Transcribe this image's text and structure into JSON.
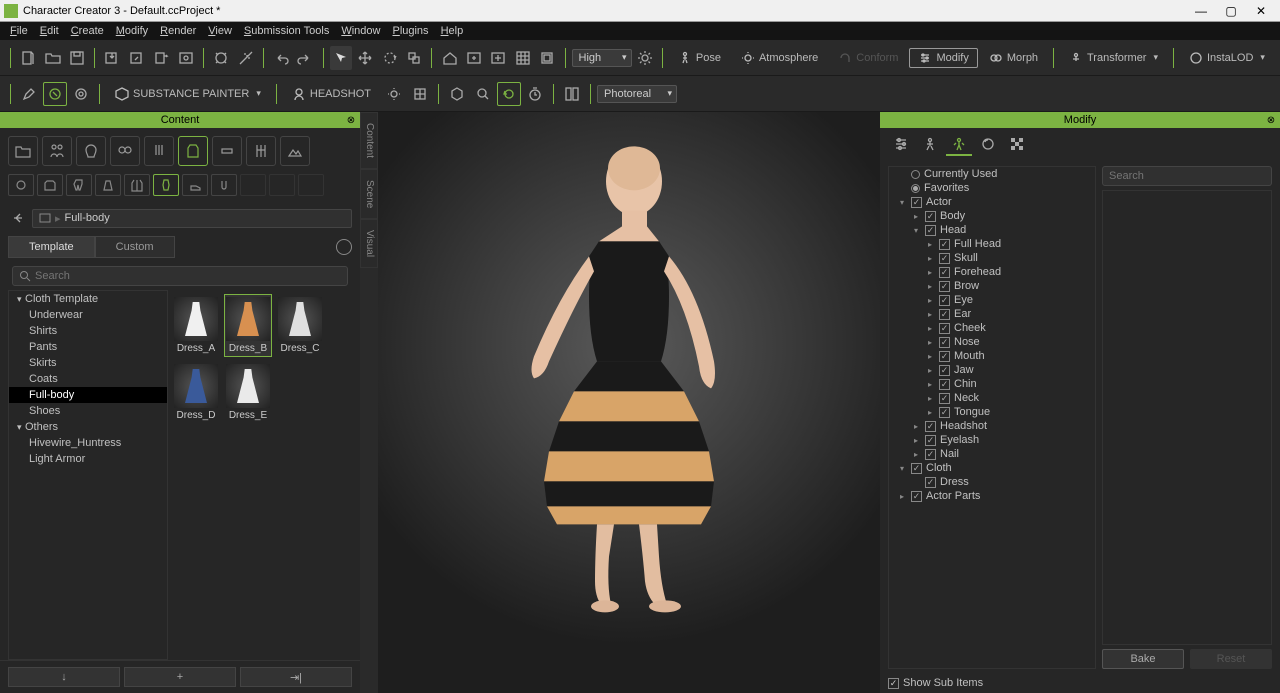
{
  "title": "Character Creator 3 - Default.ccProject *",
  "menus": [
    "File",
    "Edit",
    "Create",
    "Modify",
    "Render",
    "View",
    "Submission Tools",
    "Window",
    "Plugins",
    "Help"
  ],
  "toolbar": {
    "quality": "High",
    "render": "Photoreal",
    "pose": "Pose",
    "atmosphere": "Atmosphere",
    "conform": "Conform",
    "modify": "Modify",
    "morph": "Morph",
    "transformer": "Transformer",
    "instalod": "InstaLOD",
    "substance": "SUBSTANCE PAINTER",
    "headshot": "HEADSHOT"
  },
  "leftPanel": {
    "title": "Content",
    "breadcrumb": "Full-body",
    "tabs": {
      "template": "Template",
      "custom": "Custom"
    },
    "searchPlaceholder": "Search",
    "tree": [
      {
        "l": 1,
        "caret": "▾",
        "t": "Cloth Template"
      },
      {
        "l": 2,
        "t": "Underwear"
      },
      {
        "l": 2,
        "t": "Shirts"
      },
      {
        "l": 2,
        "t": "Pants"
      },
      {
        "l": 2,
        "t": "Skirts"
      },
      {
        "l": 2,
        "t": "Coats"
      },
      {
        "l": 2,
        "t": "Full-body",
        "sel": true
      },
      {
        "l": 2,
        "t": "Shoes"
      },
      {
        "l": 1,
        "caret": "▾",
        "t": "Others"
      },
      {
        "l": 2,
        "t": "Hivewire_Huntress"
      },
      {
        "l": 2,
        "t": "Light Armor"
      }
    ],
    "thumbs": [
      {
        "name": "Dress_A",
        "color": "#f0f0f0"
      },
      {
        "name": "Dress_B",
        "color": "#d89050",
        "sel": true
      },
      {
        "name": "Dress_C",
        "color": "#e0e0e0"
      },
      {
        "name": "Dress_D",
        "color": "#3a5a9a"
      },
      {
        "name": "Dress_E",
        "color": "#eaeaea"
      }
    ]
  },
  "vtabs": [
    "Content",
    "Scene",
    "Visual"
  ],
  "rightPanel": {
    "title": "Modify",
    "searchPlaceholder": "Search",
    "tree": [
      {
        "ind": 0,
        "radio": true,
        "t": "Currently Used"
      },
      {
        "ind": 0,
        "radio": true,
        "filled": true,
        "t": "Favorites"
      },
      {
        "ind": 0,
        "ar": "▾",
        "cb": true,
        "t": "Actor"
      },
      {
        "ind": 1,
        "ar": "▸",
        "cb": true,
        "t": "Body"
      },
      {
        "ind": 1,
        "ar": "▾",
        "cb": true,
        "t": "Head"
      },
      {
        "ind": 2,
        "ar": "▸",
        "cb": true,
        "t": "Full Head"
      },
      {
        "ind": 2,
        "ar": "▸",
        "cb": true,
        "t": "Skull"
      },
      {
        "ind": 2,
        "ar": "▸",
        "cb": true,
        "t": "Forehead"
      },
      {
        "ind": 2,
        "ar": "▸",
        "cb": true,
        "t": "Brow"
      },
      {
        "ind": 2,
        "ar": "▸",
        "cb": true,
        "t": "Eye"
      },
      {
        "ind": 2,
        "ar": "▸",
        "cb": true,
        "t": "Ear"
      },
      {
        "ind": 2,
        "ar": "▸",
        "cb": true,
        "t": "Cheek"
      },
      {
        "ind": 2,
        "ar": "▸",
        "cb": true,
        "t": "Nose"
      },
      {
        "ind": 2,
        "ar": "▸",
        "cb": true,
        "t": "Mouth"
      },
      {
        "ind": 2,
        "ar": "▸",
        "cb": true,
        "t": "Jaw"
      },
      {
        "ind": 2,
        "ar": "▸",
        "cb": true,
        "t": "Chin"
      },
      {
        "ind": 2,
        "ar": "▸",
        "cb": true,
        "t": "Neck"
      },
      {
        "ind": 2,
        "ar": "▸",
        "cb": true,
        "t": "Tongue"
      },
      {
        "ind": 1,
        "ar": "▸",
        "cb": true,
        "t": "Headshot"
      },
      {
        "ind": 1,
        "ar": "▸",
        "cb": true,
        "t": "Eyelash"
      },
      {
        "ind": 1,
        "ar": "▸",
        "cb": true,
        "t": "Nail"
      },
      {
        "ind": 0,
        "ar": "▾",
        "cb": true,
        "t": "Cloth"
      },
      {
        "ind": 1,
        "ar": "",
        "cb": true,
        "t": "Dress"
      },
      {
        "ind": 0,
        "ar": "▸",
        "cb": true,
        "t": "Actor Parts"
      }
    ],
    "bake": "Bake",
    "reset": "Reset",
    "showSub": "Show Sub Items"
  }
}
